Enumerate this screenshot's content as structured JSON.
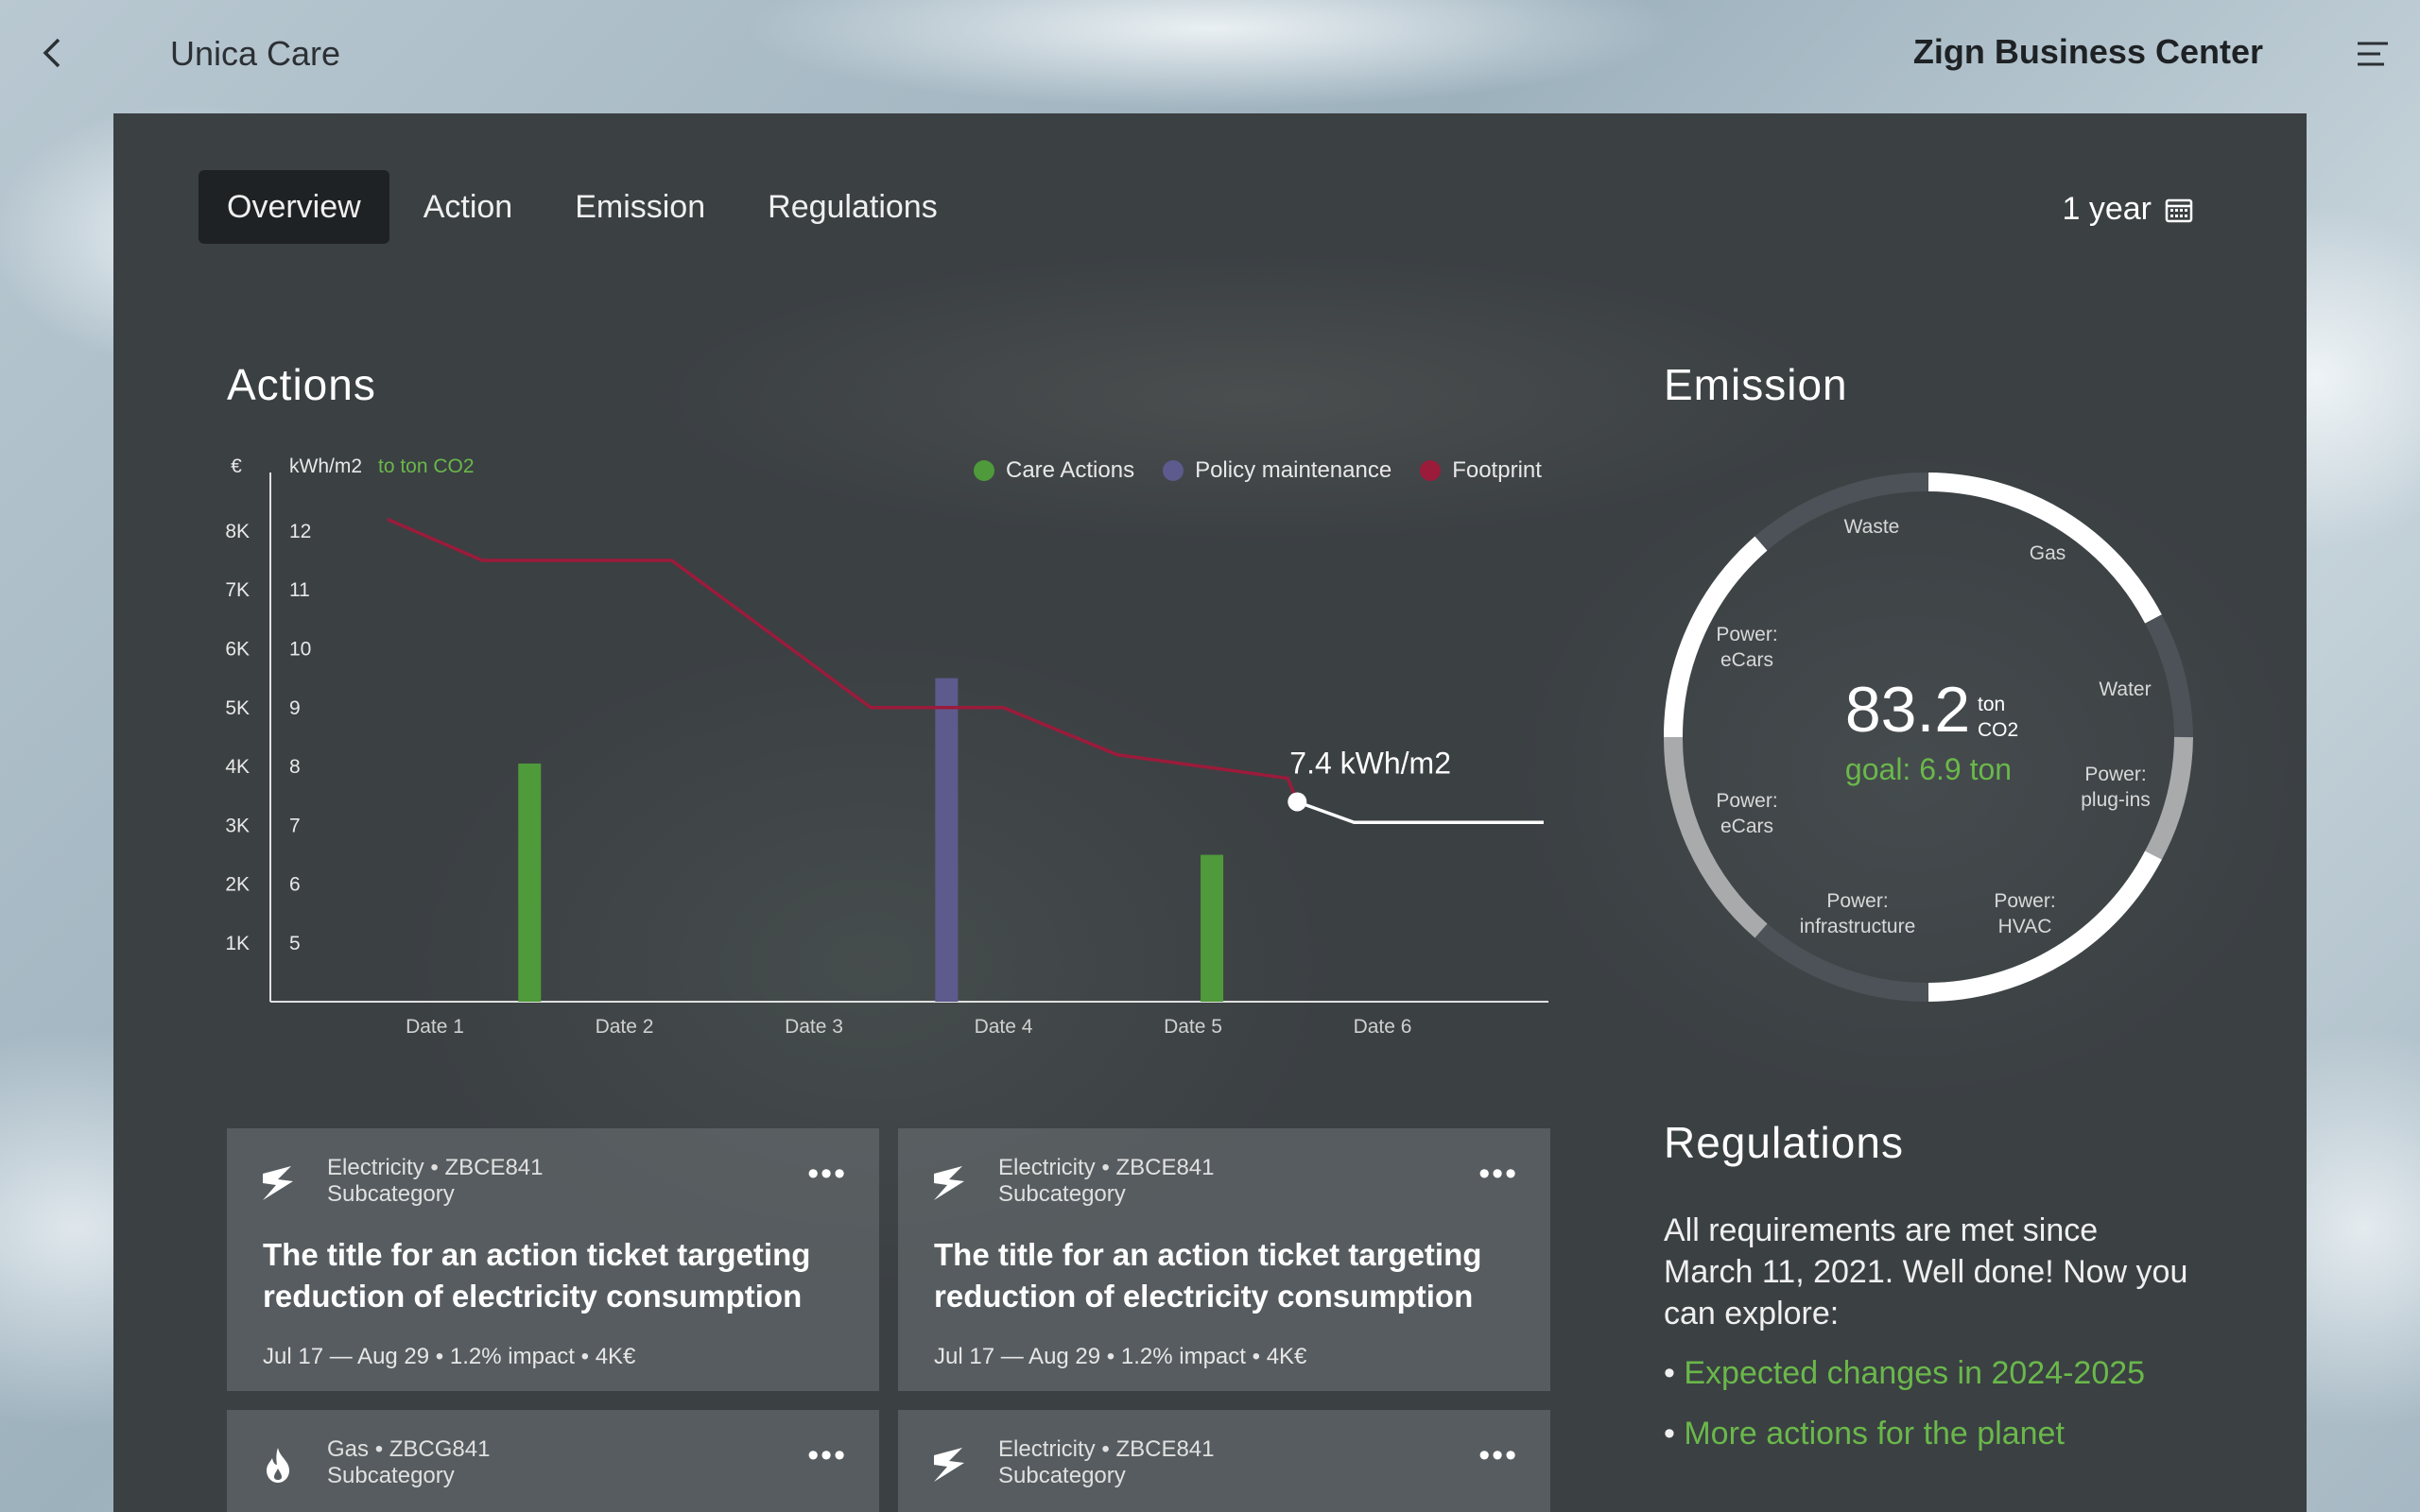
{
  "topbar": {
    "app_name": "Unica Care",
    "center_name": "Zign Business Center"
  },
  "tabs": [
    {
      "label": "Overview",
      "active": true
    },
    {
      "label": "Action",
      "active": false
    },
    {
      "label": "Emission",
      "active": false
    },
    {
      "label": "Regulations",
      "active": false
    }
  ],
  "period": {
    "label": "1 year",
    "icon": "calendar-icon"
  },
  "actions": {
    "title": "Actions"
  },
  "emission": {
    "title": "Emission",
    "value": "83.2",
    "unit_line1": "ton",
    "unit_line2": "CO2",
    "goal": "goal: 6.9 ton",
    "segments": [
      "Waste",
      "Gas",
      "Water",
      "Power: plug-ins",
      "Power: HVAC",
      "Power: infrastructure",
      "Power: eCars",
      "Power: eCars"
    ],
    "segment_labels": {
      "waste": "Waste",
      "gas": "Gas",
      "water": "Water",
      "plugins": [
        "Power:",
        "plug-ins"
      ],
      "hvac": [
        "Power:",
        "HVAC"
      ],
      "infra": [
        "Power:",
        "infrastructure"
      ],
      "ecars_bottom": [
        "Power:",
        "eCars"
      ],
      "ecars_top": [
        "Power:",
        "eCars"
      ]
    }
  },
  "chart_data": {
    "type": "bar",
    "title": "",
    "y_left_label": "€",
    "y_right_label": "kWh/m2",
    "y_right_sublabel": "to ton CO2",
    "y_left_ticks": [
      "1K",
      "2K",
      "3K",
      "4K",
      "5K",
      "6K",
      "7K",
      "8K"
    ],
    "y_right_ticks": [
      "5",
      "6",
      "7",
      "8",
      "9",
      "10",
      "11",
      "12"
    ],
    "categories": [
      "Date 1",
      "Date 2",
      "Date 3",
      "Date 4",
      "Date 5",
      "Date 6"
    ],
    "legend": [
      {
        "name": "Care Actions",
        "color": "#4f9a3a"
      },
      {
        "name": "Policy maintenance",
        "color": "#5d5a8e"
      },
      {
        "name": "Footprint",
        "color": "#9b1b3b"
      }
    ],
    "bars": [
      {
        "series": "Care Actions",
        "x": 1.5,
        "value": 4050
      },
      {
        "series": "Policy maintenance",
        "x": 3.7,
        "value": 5500
      },
      {
        "series": "Care Actions",
        "x": 5.1,
        "value": 2500
      }
    ],
    "footprint_line": [
      {
        "x": 0.75,
        "y": 12.2
      },
      {
        "x": 1.25,
        "y": 11.5
      },
      {
        "x": 2.25,
        "y": 11.5
      },
      {
        "x": 3.3,
        "y": 9.0
      },
      {
        "x": 4.0,
        "y": 9.0
      },
      {
        "x": 4.6,
        "y": 8.2
      },
      {
        "x": 5.5,
        "y": 7.8
      },
      {
        "x": 5.55,
        "y": 7.4
      }
    ],
    "forecast_line": [
      {
        "x": 5.55,
        "y": 7.4
      },
      {
        "x": 5.85,
        "y": 7.05
      },
      {
        "x": 6.85,
        "y": 7.05
      }
    ],
    "annotation": "7.4 kWh/m2",
    "ylim_left": [
      0,
      9000
    ],
    "ylim_right": [
      4,
      13
    ]
  },
  "cards": [
    {
      "category": "Electricity",
      "code": "ZBCE841",
      "sub": "Subcategory",
      "icon": "lightning-icon",
      "title": "The title for an action ticket targeting reduction of electricity consumption",
      "dates": "Jul 17 — Aug 29",
      "impact": "1.2% impact",
      "cost": "4K€"
    },
    {
      "category": "Electricity",
      "code": "ZBCE841",
      "sub": "Subcategory",
      "icon": "lightning-icon",
      "title": "The title for an action ticket targeting reduction of electricity consumption",
      "dates": "Jul 17 — Aug 29",
      "impact": "1.2% impact",
      "cost": "4K€"
    },
    {
      "category": "Gas",
      "code": "ZBCG841",
      "sub": "Subcategory",
      "icon": "flame-icon"
    },
    {
      "category": "Electricity",
      "code": "ZBCE841",
      "sub": "Subcategory",
      "icon": "lightning-icon"
    }
  ],
  "regulations": {
    "title": "Regulations",
    "text": "All requirements are met since March 11, 2021. Well done! Now you can explore:",
    "links": [
      "Expected changes in 2024-2025",
      "More actions for the planet"
    ],
    "link_color": "#6ab84a"
  },
  "more_label": "•••",
  "bullet": "•",
  "sep": "•"
}
